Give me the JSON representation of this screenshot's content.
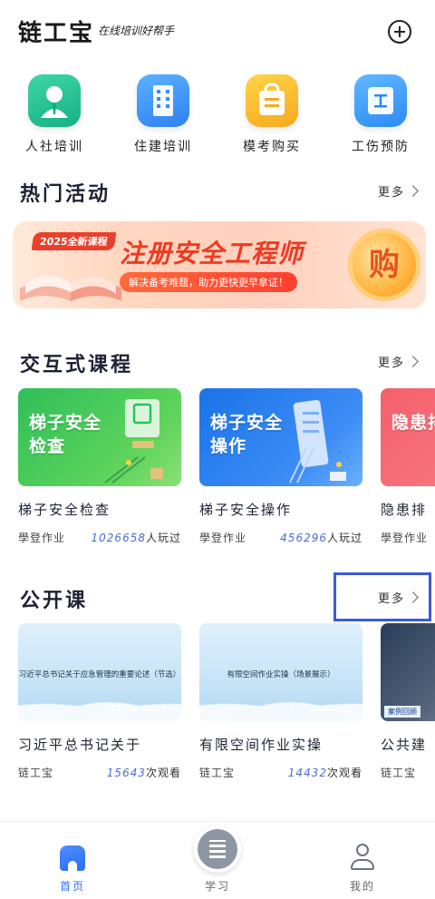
{
  "header": {
    "logo": "链工宝",
    "slogan": "在线培训好帮手"
  },
  "shortcuts": [
    {
      "label": "人社培训",
      "icon": "person-badge-icon",
      "color": "#1fbf8d"
    },
    {
      "label": "住建培训",
      "icon": "building-icon",
      "color": "#3a8cf5"
    },
    {
      "label": "模考购买",
      "icon": "shopping-bag-icon",
      "color": "#f9b629"
    },
    {
      "label": "工伤预防",
      "icon": "shield-document-icon",
      "color": "#3592f5"
    }
  ],
  "hot_activities": {
    "title": "热门活动",
    "more": "更多",
    "banner": {
      "year_tag": "2025全新课程",
      "headline": "注册安全工程师",
      "subline": "解决备考难题，助力更快更早拿证！",
      "buy_label": "购"
    }
  },
  "interactive_courses": {
    "title": "交互式课程",
    "more": "更多",
    "items": [
      {
        "thumb_text": "梯子安全\n检查",
        "title": "梯子安全检查",
        "source": "學登作业",
        "count": "1026658",
        "count_suffix": "人玩过"
      },
      {
        "thumb_text": "梯子安全\n操作",
        "title": "梯子安全操作",
        "source": "學登作业",
        "count": "456296",
        "count_suffix": "人玩过"
      },
      {
        "thumb_text": "隐患排",
        "title": "隐患排",
        "source": "學登作业",
        "count": "",
        "count_suffix": ""
      }
    ]
  },
  "open_courses": {
    "title": "公开课",
    "more": "更多",
    "items": [
      {
        "caption": "习近平总书记关于应急管理的重要论述（节选）",
        "duration": "00:00:06:31",
        "title": "习近平总书记关于",
        "source": "链工宝",
        "count": "15643",
        "count_suffix": "次观看"
      },
      {
        "caption": "有限空间作业实操（场景展示）",
        "duration": "00:00:01:10",
        "title": "有限空间作业实操",
        "source": "链工宝",
        "count": "14432",
        "count_suffix": "次观看"
      },
      {
        "caption": "",
        "duration": "",
        "title": "公共建",
        "source": "链工宝",
        "count": "",
        "count_suffix": "",
        "tag": "案例回顾"
      }
    ]
  },
  "tabbar": [
    {
      "label": "首页",
      "icon": "home-icon",
      "active": true
    },
    {
      "label": "学习",
      "icon": "study-icon",
      "active": false
    },
    {
      "label": "我的",
      "icon": "profile-icon",
      "active": false
    }
  ],
  "colors": {
    "accent": "#2d6ff0",
    "highlight_box": "#3b59d8",
    "count_number": "#4a6cd4"
  }
}
